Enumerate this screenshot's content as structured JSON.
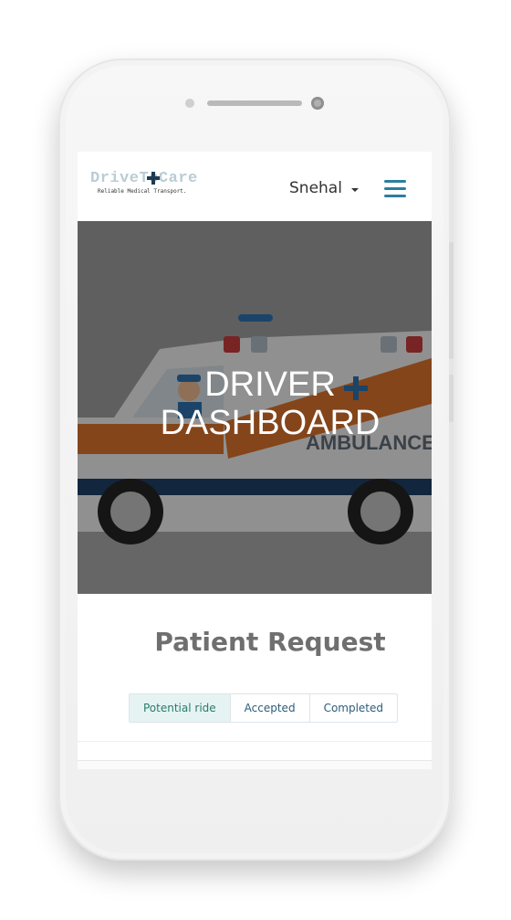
{
  "app": {
    "logo_text": "DriveToCare",
    "logo_tagline": "Reliable Medical Transport.",
    "user_name": "Snehal"
  },
  "hero": {
    "title_line1": "DRIVER",
    "title_line2": "DASHBOARD",
    "vehicle_text": "AMBULANCE"
  },
  "main": {
    "section_title": "Patient Request",
    "tabs": [
      {
        "label": "Potential ride",
        "active": true
      },
      {
        "label": "Accepted",
        "active": false
      },
      {
        "label": "Completed",
        "active": false
      }
    ]
  },
  "colors": {
    "accent": "#2b7ea1",
    "active_tab_bg": "#e5f4f2",
    "ambulance_orange": "#d5702a"
  },
  "icons": {
    "menu": "hamburger-icon",
    "caret": "caret-down-icon",
    "camera": "camera-icon",
    "star_of_life": "star-of-life-icon"
  }
}
